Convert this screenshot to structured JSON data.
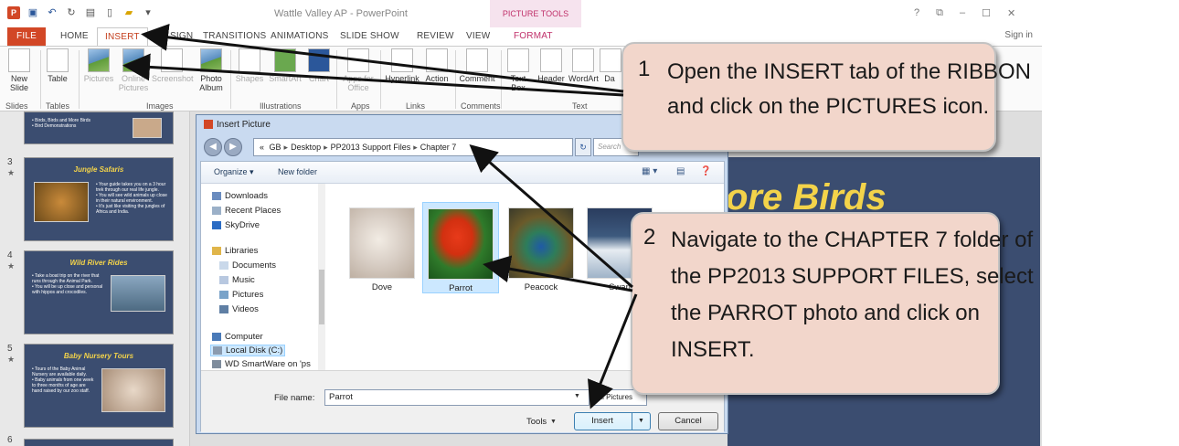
{
  "titlebar": {
    "title": "Wattle Valley AP - PowerPoint",
    "picture_tools": "PICTURE TOOLS",
    "help": "?",
    "restore": "⧉",
    "minimize": "–",
    "maximize": "☐",
    "close": "✕"
  },
  "tabs": {
    "file": "FILE",
    "home": "HOME",
    "insert": "INSERT",
    "design": "SIGN",
    "transitions": "TRANSITIONS",
    "animations": "ANIMATIONS",
    "slideshow": "SLIDE SHOW",
    "review": "REVIEW",
    "view": "VIEW",
    "format": "FORMAT",
    "sign_in": "Sign in"
  },
  "ribbon": {
    "new_slide": "New Slide",
    "table": "Table",
    "pictures": "Pictures",
    "online_pictures_1": "Online",
    "online_pictures_2": "Pictures",
    "screenshot": "Screenshot",
    "photo_album_1": "Photo",
    "photo_album_2": "Album",
    "shapes": "Shapes",
    "smartart": "SmartArt",
    "chart": "Chart",
    "apps_1": "Apps for",
    "apps_2": "Office",
    "hyperlink": "Hyperlink",
    "action": "Action",
    "comment": "Comment",
    "textbox": "Text Box",
    "header_footer": "Header",
    "wordart": "WordArt",
    "date": "Da",
    "groups": {
      "slides": "Slides",
      "tables": "Tables",
      "images": "Images",
      "illustrations": "Illustrations",
      "apps": "Apps",
      "links": "Links",
      "comments": "Comments",
      "text": "Text"
    }
  },
  "thumbs": [
    {
      "num": "",
      "title": "",
      "body": "• Birds, Birds and More Birds\n• Bird Demonstrations"
    },
    {
      "num": "3",
      "title": "Jungle Safaris",
      "body": "• Your guide takes you on a 3 hour trek through our real life jungle.\n• You will see wild animals up close in their natural environment.\n• It's just like visiting the jungles of Africa and India."
    },
    {
      "num": "4",
      "title": "Wild River Rides",
      "body": "• Take a boat trip on the river that runs through the Animal Park.\n• You will be up close and personal with hippos and crocodiles."
    },
    {
      "num": "5",
      "title": "Baby Nursery Tours",
      "body": "• Tours of the Baby Animal Nursery are available daily.\n• Baby animals from one week to three months of age are hand raised by our zoo staff."
    },
    {
      "num": "6"
    }
  ],
  "slide": {
    "heading": "ore Birds"
  },
  "dialog": {
    "title": "Insert Picture",
    "path": [
      "«",
      "GB",
      "Desktop",
      "PP2013 Support Files",
      "Chapter 7"
    ],
    "search_placeholder": "Search",
    "organize": "Organize ▾",
    "new_folder": "New folder",
    "nav": {
      "downloads": "Downloads",
      "recent_places": "Recent Places",
      "skydrive": "SkyDrive",
      "libraries": "Libraries",
      "documents": "Documents",
      "music": "Music",
      "pictures": "Pictures",
      "videos": "Videos",
      "computer": "Computer",
      "local_disk": "Local Disk (C:)",
      "wd": "WD SmartWare on 'ps"
    },
    "files": [
      "Dove",
      "Parrot",
      "Peacock",
      "Swan"
    ],
    "file_name_label": "File name:",
    "file_name_value": "Parrot",
    "file_type": "All Pictures",
    "tools": "Tools",
    "insert": "Insert",
    "cancel": "Cancel"
  },
  "callouts": {
    "c1_num": "1",
    "c1_line1": "Open the INSERT tab of the RIBBON",
    "c1_line2": "and click on the PICTURES icon.",
    "c2_num": "2",
    "c2_line1": "Navigate to the CHAPTER 7 folder of",
    "c2_line2": "the PP2013 SUPPORT FILES, select",
    "c2_line3": "the PARROT photo and click on",
    "c2_line4": "INSERT."
  }
}
